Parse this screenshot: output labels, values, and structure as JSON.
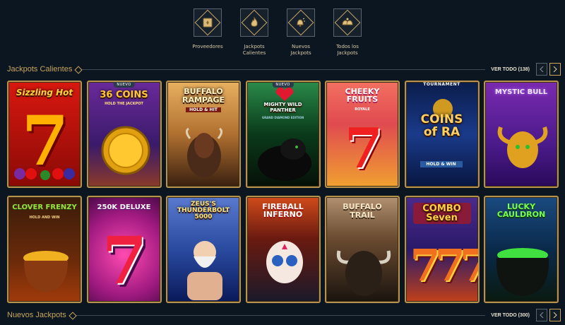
{
  "categories": [
    {
      "label": "Proveedores",
      "icon": "book-icon"
    },
    {
      "label": "Jackpots\nCalientes",
      "icon": "flame-icon"
    },
    {
      "label": "Nuevos\nJackpots",
      "icon": "bells-icon"
    },
    {
      "label": "Todos los\nJackpots",
      "icon": "all-bells-icon"
    }
  ],
  "sections": {
    "hot": {
      "title": "Jackpots Calientes",
      "see_all": "VER TODO (138)"
    },
    "new": {
      "title": "Nuevos Jackpots",
      "see_all": "VER TODO (300)"
    }
  },
  "games": [
    {
      "title": "Sizzling Hot",
      "badge": "",
      "subtitle": "",
      "colors": [
        "#c4140f",
        "#7a0806"
      ]
    },
    {
      "title": "36 COINS",
      "badge": "NUEVO",
      "subtitle": "HOLD THE JACKPOT",
      "colors": [
        "#5a2a8c",
        "#b04a2a"
      ]
    },
    {
      "title": "BUFFALO\nRAMPAGE",
      "badge": "",
      "subtitle": "HOLD & HIT",
      "colors": [
        "#d9a24e",
        "#4a2a16"
      ]
    },
    {
      "title": "MIGHTY WILD\nPANTHER",
      "badge": "NUEVO",
      "subtitle": "GRAND DIAMOND EDITION",
      "colors": [
        "#1e6a3a",
        "#0a2014"
      ]
    },
    {
      "title": "CHEEKY\nFRUITS",
      "badge": "",
      "subtitle": "ROYALE",
      "colors": [
        "#f06a5a",
        "#e0a030"
      ]
    },
    {
      "title": "COINS\nof RA",
      "badge": "TOURNAMENT",
      "subtitle": "HOLD & WIN",
      "colors": [
        "#1a3a8a",
        "#0a1840"
      ]
    },
    {
      "title": "MYSTIC BULL",
      "badge": "",
      "subtitle": "",
      "colors": [
        "#5a1a8a",
        "#2a0a4a"
      ]
    },
    {
      "title": "CLOVER FRENZY",
      "badge": "",
      "subtitle": "HOLD AND WIN",
      "colors": [
        "#3a1a08",
        "#8a2a0a"
      ]
    },
    {
      "title": "250K DELUXE",
      "badge": "",
      "subtitle": "",
      "colors": [
        "#c82a8a",
        "#5a0a4a"
      ]
    },
    {
      "title": "ZEUS'S\nTHUNDERBOLT\n5000",
      "badge": "",
      "subtitle": "",
      "colors": [
        "#3a5ab0",
        "#0a1a4a"
      ]
    },
    {
      "title": "FIREBALL\nINFERNO",
      "badge": "",
      "subtitle": "",
      "colors": [
        "#c0401a",
        "#1a1a2a"
      ]
    },
    {
      "title": "BUFFALO\nTRAIL",
      "badge": "",
      "subtitle": "",
      "colors": [
        "#8a6a4a",
        "#2a1a10"
      ]
    },
    {
      "title": "COMBO\nSeven",
      "badge": "",
      "subtitle": "",
      "colors": [
        "#3a1a6a",
        "#c0401a"
      ]
    },
    {
      "title": "LUCKY\nCAULDRON",
      "badge": "",
      "subtitle": "",
      "colors": [
        "#1a4a7a",
        "#0a2a1a"
      ]
    }
  ],
  "colors": {
    "accent": "#c9a65c",
    "background": "#0b1620"
  }
}
